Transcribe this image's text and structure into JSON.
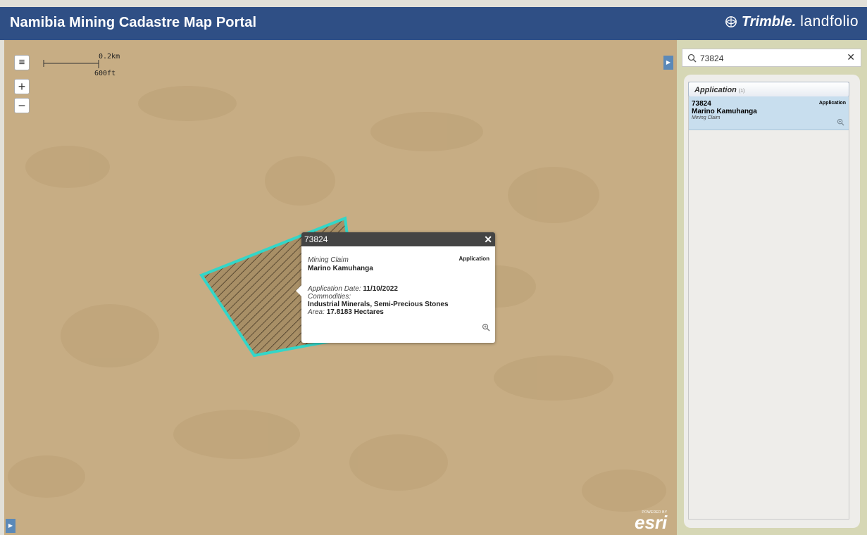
{
  "header": {
    "title": "Namibia Mining Cadastre Map Portal",
    "brand_primary": "Trimble.",
    "brand_secondary": "landfolio",
    "bg_color": "#2f4f85"
  },
  "map": {
    "scale_km": "0.2km",
    "scale_ft": "600ft",
    "menu_icon": "≡",
    "zoom_in": "+",
    "zoom_out": "−",
    "esri_powered": "POWERED BY",
    "esri_word": "esri",
    "parcel_outline_color": "#33d6c8"
  },
  "popup": {
    "title": "73824",
    "close": "✕",
    "type": "Mining Claim",
    "status": "Application",
    "owner": "Marino Kamuhanga",
    "app_date_label": "Application Date:",
    "app_date_value": "11/10/2022",
    "commodities_label": "Commodities:",
    "commodities_value": "Industrial Minerals, Semi-Precious Stones",
    "area_label": "Area:",
    "area_value": "17.8183 Hectares"
  },
  "panel": {
    "search_value": "73824",
    "clear": "✕",
    "group": {
      "name": "Application",
      "count": "(1)"
    },
    "results": [
      {
        "id": "73824",
        "status": "Application",
        "owner": "Marino Kamuhanga",
        "type": "Mining Claim"
      }
    ]
  }
}
